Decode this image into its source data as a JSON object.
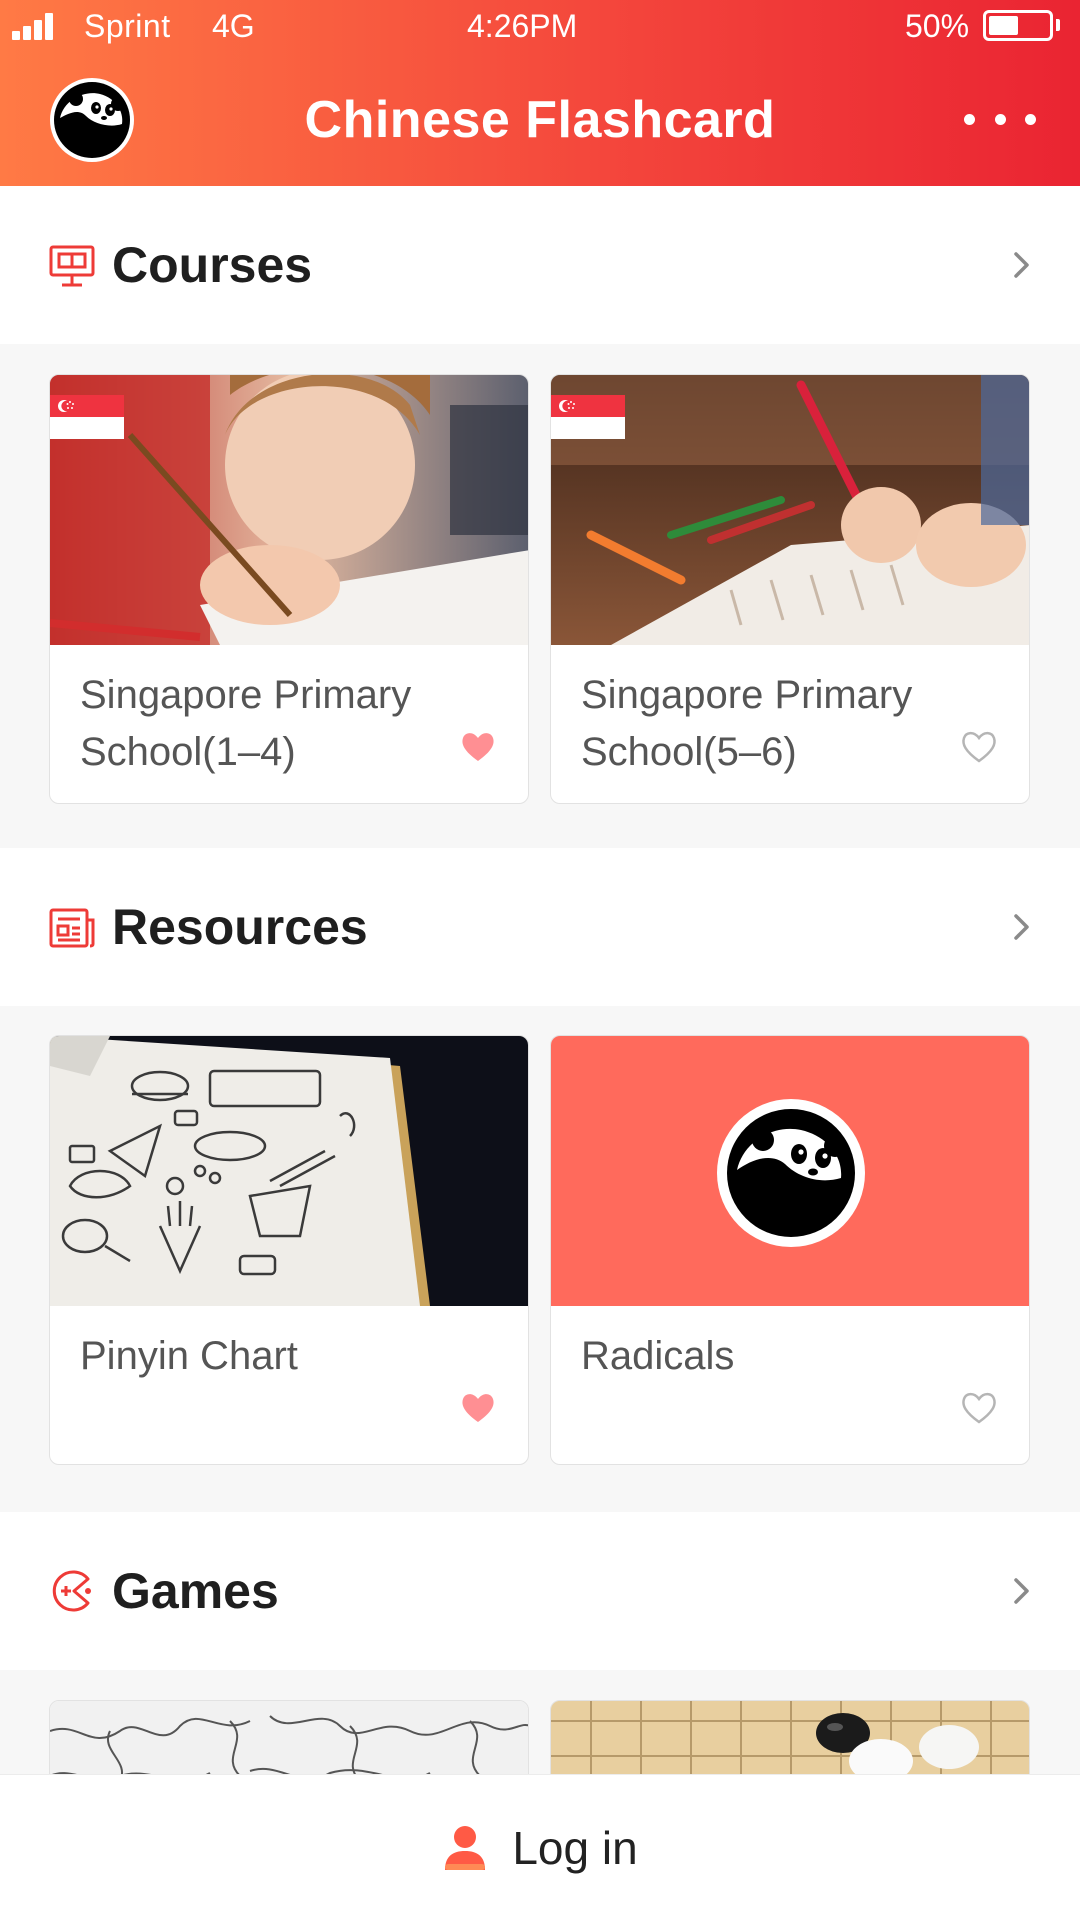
{
  "status_bar": {
    "carrier": "Sprint",
    "network": "4G",
    "time": "4:26PM",
    "battery_percent_text": "50%",
    "battery_level": 0.5
  },
  "header": {
    "title": "Chinese Flashcard",
    "logo_icon": "panda-logo-icon",
    "menu_icon": "more-dots-icon"
  },
  "sections": {
    "courses": {
      "title": "Courses",
      "icon": "presentation-board-icon",
      "cards": [
        {
          "title": "Singapore Primary School(1–4)",
          "favorited": true,
          "flag": "singapore-flag-icon"
        },
        {
          "title": "Singapore Primary School(5–6)",
          "favorited": false,
          "flag": "singapore-flag-icon"
        }
      ]
    },
    "resources": {
      "title": "Resources",
      "icon": "newspaper-icon",
      "cards": [
        {
          "title": "Pinyin Chart",
          "favorited": true
        },
        {
          "title": "Radicals",
          "favorited": false
        }
      ]
    },
    "games": {
      "title": "Games",
      "icon": "gamepad-icon"
    }
  },
  "login": {
    "label": "Log in",
    "icon": "user-icon"
  },
  "colors": {
    "header_gradient_start": "#ff7a45",
    "header_gradient_end": "#ea2432",
    "accent": "#ee3b37",
    "heart_filled": "#ff8f93",
    "heart_outline": "#b5b5b5",
    "radicals_card_bg": "#ff6a5c"
  }
}
